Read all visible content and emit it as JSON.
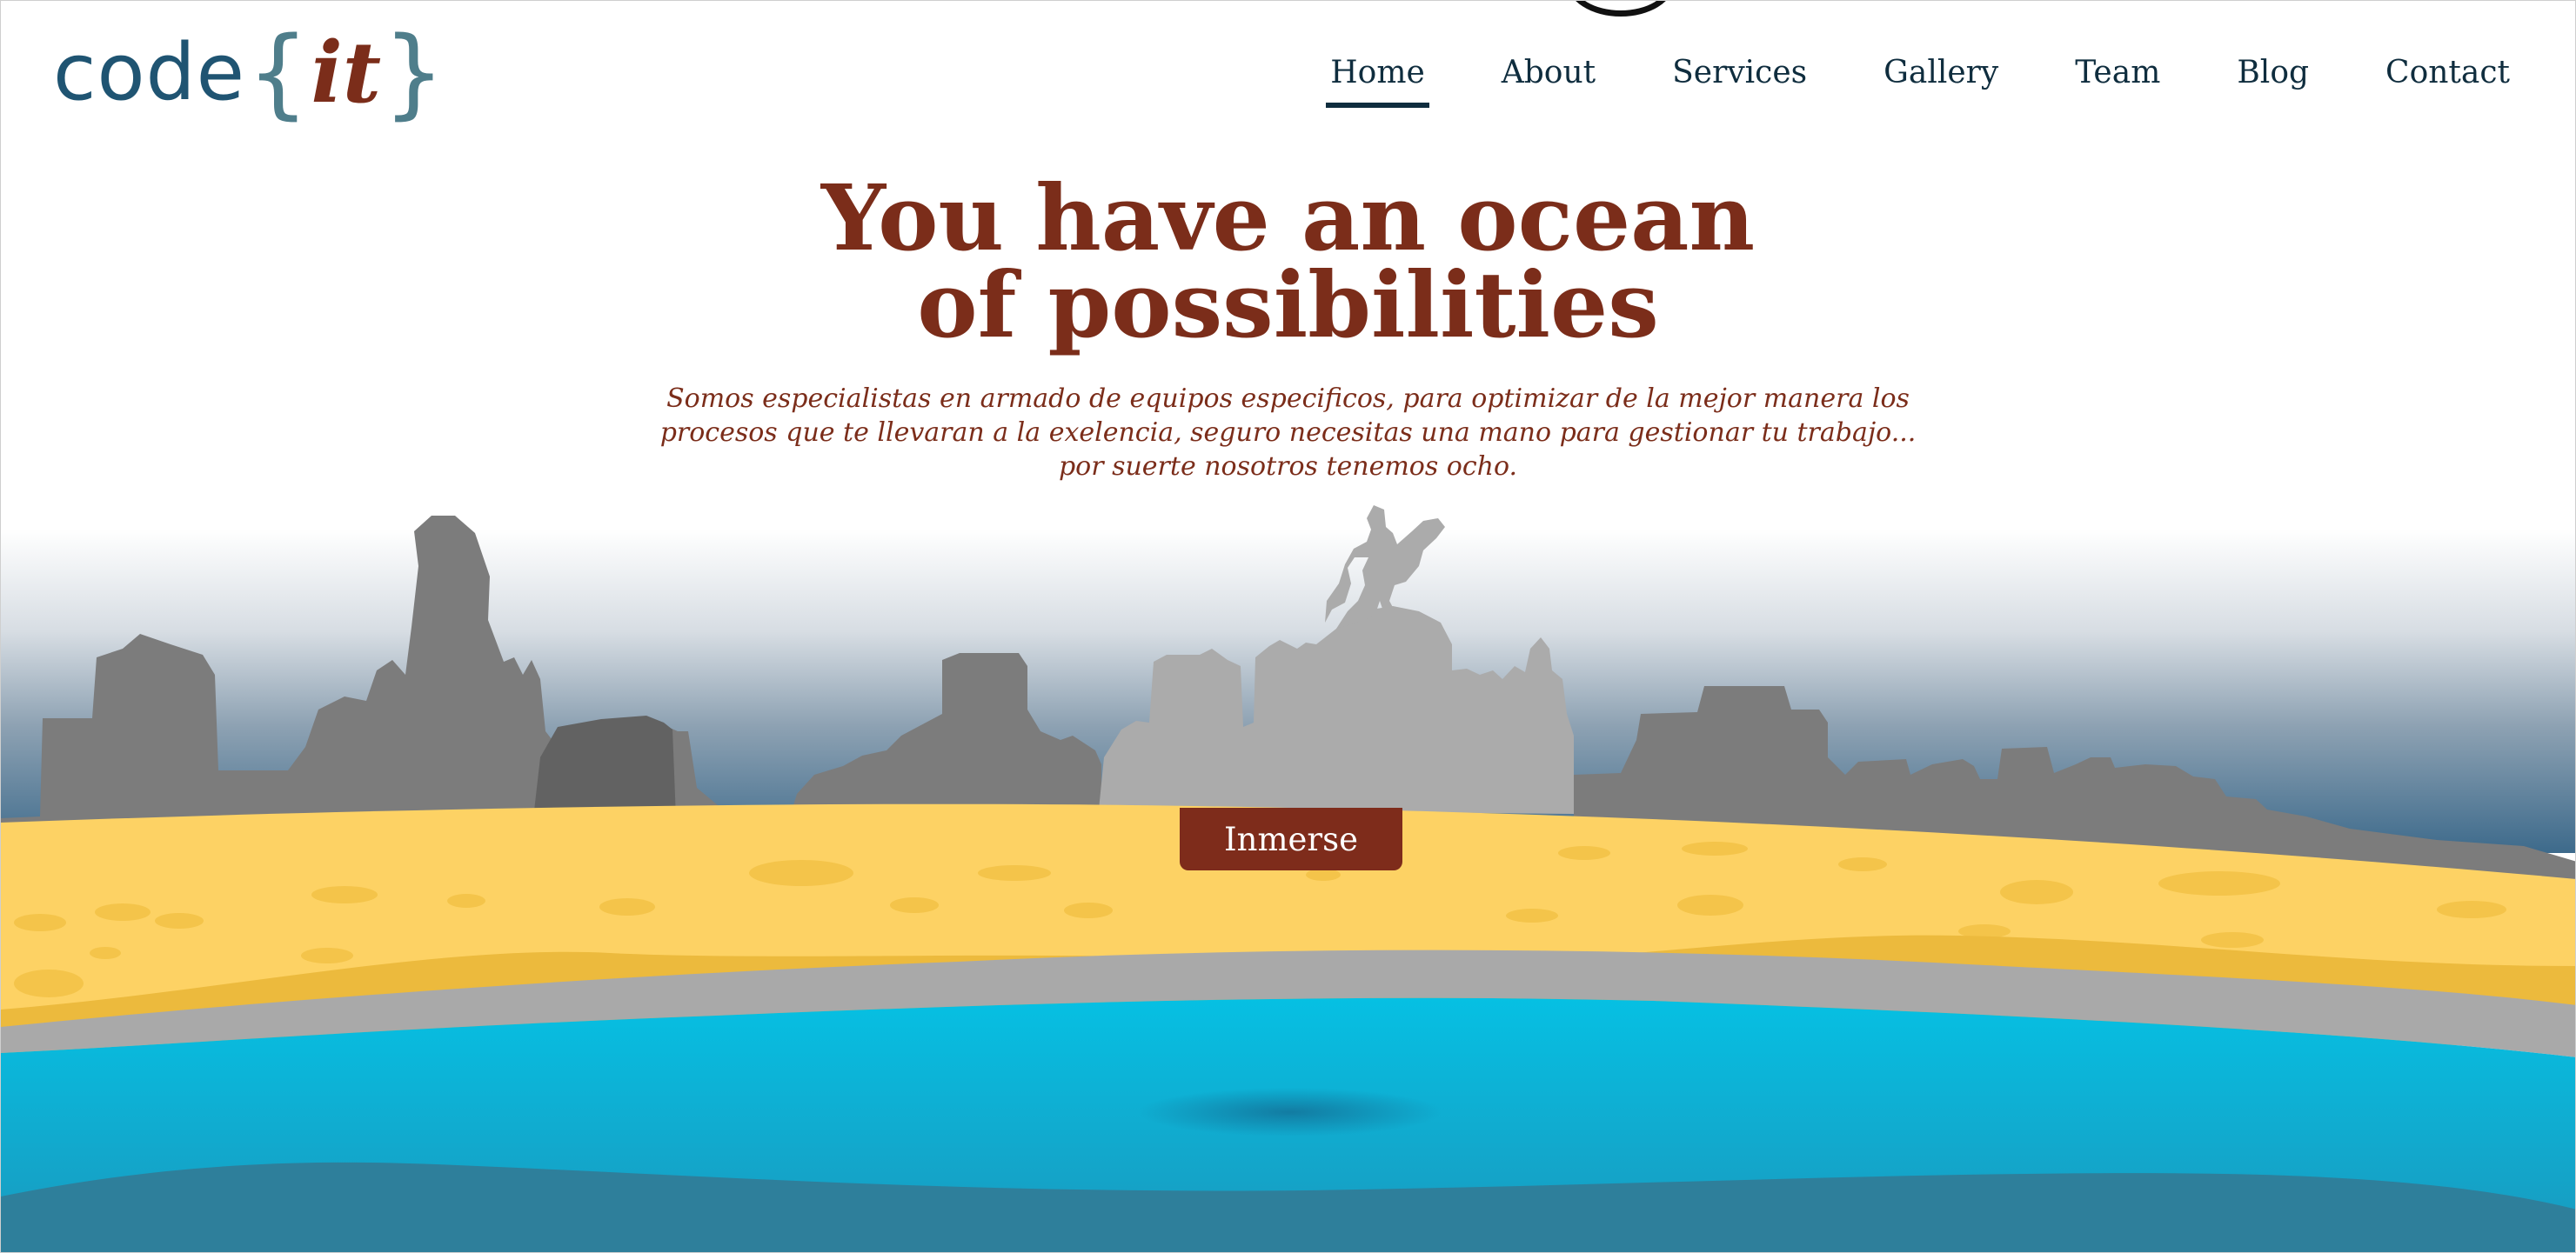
{
  "brand": {
    "word": "code",
    "open_brace": "{",
    "accent": "it",
    "close_brace": "}"
  },
  "nav": {
    "items": [
      "Home",
      "About",
      "Services",
      "Gallery",
      "Team",
      "Blog",
      "Contact"
    ],
    "active": "Home"
  },
  "hero": {
    "title_lines": [
      "You have an ocean",
      "of possibilities"
    ],
    "subtitle_lines": [
      "Somos especialistas en armado de equipos especificos, para optimizar de la mejor manera los",
      "procesos que te llevaran a la exelencia, seguro necesitas una mano para gestionar tu trabajo...",
      "por suerte nosotros tenemos ocho."
    ],
    "cta_label": "Inmerse"
  },
  "colors": {
    "brand_blue": "#1f5472",
    "brand_rust": "#7b2d1a",
    "nav_text": "#0f2d3e",
    "sand": "#fdd264",
    "sand_dark": "#ecba3d",
    "shore": "#a9a9a9",
    "sea": "#0bb8dd",
    "sea_deep": "#2e7f9b",
    "skyline": "#7c7c7c",
    "monument": "#ababab"
  },
  "icons": {
    "logo": "codeit-logo",
    "monument": "equestrian-statue-silhouette",
    "skyline": "city-skyline-silhouette"
  }
}
